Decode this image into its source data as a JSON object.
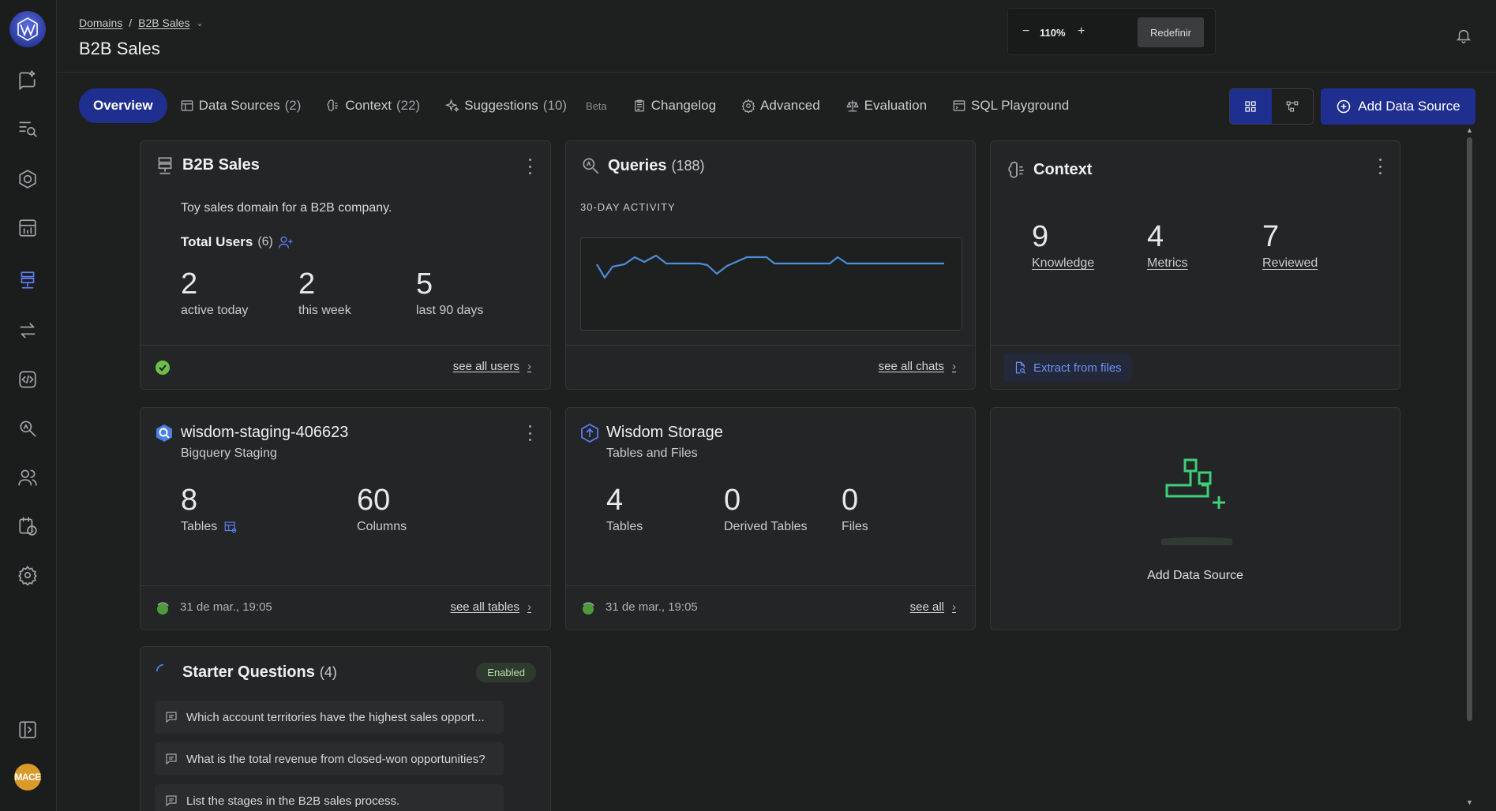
{
  "breadcrumb": {
    "root": "Domains",
    "separator": "/",
    "current": "B2B Sales"
  },
  "page_title": "B2B Sales",
  "zoom": {
    "value": "110%",
    "minus": "−",
    "plus": "+",
    "reset_label": "Redefinir"
  },
  "tabs": [
    {
      "label": "Overview",
      "count": ""
    },
    {
      "label": "Data Sources",
      "count": "(2)"
    },
    {
      "label": "Context",
      "count": "(22)"
    },
    {
      "label": "Suggestions",
      "count": "(10)",
      "badge": "Beta"
    },
    {
      "label": "Changelog",
      "count": ""
    },
    {
      "label": "Advanced",
      "count": ""
    },
    {
      "label": "Evaluation",
      "count": ""
    },
    {
      "label": "SQL Playground",
      "count": ""
    }
  ],
  "actions": {
    "add_data_source": "Add Data Source"
  },
  "domain_card": {
    "title": "B2B Sales",
    "description": "Toy sales domain for a B2B company.",
    "users_label": "Total Users",
    "users_count": "(6)",
    "stats": [
      {
        "value": "2",
        "label": "active today"
      },
      {
        "value": "2",
        "label": "this week"
      },
      {
        "value": "5",
        "label": "last 90 days"
      }
    ],
    "footer_link": "see all users"
  },
  "queries_card": {
    "title": "Queries",
    "count": "(188)",
    "activity_label": "30-DAY ACTIVITY",
    "footer_link": "see all chats"
  },
  "context_card": {
    "title": "Context",
    "stats": [
      {
        "value": "9",
        "label": "Knowledge"
      },
      {
        "value": "4",
        "label": "Metrics"
      },
      {
        "value": "7",
        "label": "Reviewed"
      }
    ],
    "extract_label": "Extract from files"
  },
  "bigquery_card": {
    "title": "wisdom-staging-406623",
    "subtitle": "Bigquery Staging",
    "stats": [
      {
        "value": "8",
        "label": "Tables"
      },
      {
        "value": "60",
        "label": "Columns"
      }
    ],
    "timestamp": "31 de mar., 19:05",
    "footer_link": "see all tables"
  },
  "storage_card": {
    "title": "Wisdom Storage",
    "subtitle": "Tables and Files",
    "stats": [
      {
        "value": "4",
        "label": "Tables"
      },
      {
        "value": "0",
        "label": "Derived Tables"
      },
      {
        "value": "0",
        "label": "Files"
      }
    ],
    "timestamp": "31 de mar., 19:05",
    "footer_link": "see all"
  },
  "add_source_card": {
    "label": "Add Data Source"
  },
  "starter_card": {
    "title": "Starter Questions",
    "count": "(4)",
    "badge": "Enabled",
    "questions": [
      "Which account territories have the highest sales opport...",
      "What is the total revenue from closed-won opportunities?",
      "List the stages in the B2B sales process."
    ]
  },
  "user": {
    "avatar_text": "MACE"
  },
  "colors": {
    "accent": "#1f2f8f",
    "sparkline": "#4a8fd8",
    "success": "#6cc04a",
    "add_green": "#3ecf7a"
  }
}
